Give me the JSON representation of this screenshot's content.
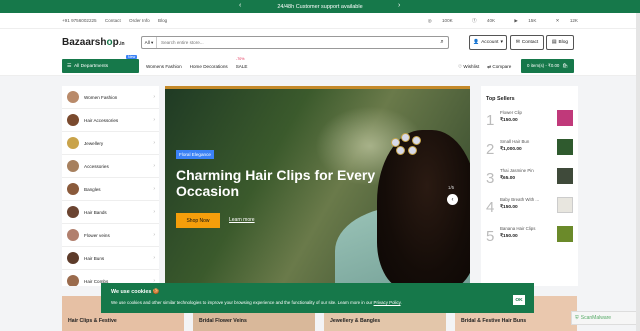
{
  "announcement": {
    "text": "24/48h Customer support available",
    "prev": "‹",
    "next": "›"
  },
  "topbar": {
    "phone": "+91 9756002225",
    "links": [
      "Contact",
      "Order Info",
      "Blog"
    ],
    "social": [
      {
        "icon": "instagram-icon",
        "glyph": "◎",
        "count": "100K"
      },
      {
        "icon": "facebook-icon",
        "glyph": "ⓕ",
        "count": "40K"
      },
      {
        "icon": "youtube-icon",
        "glyph": "▶",
        "count": "15K"
      },
      {
        "icon": "twitter-icon",
        "glyph": "✕",
        "count": "12K"
      }
    ]
  },
  "header": {
    "logo_main": "Bazaarsh",
    "logo_o": "o",
    "logo_end": "p",
    "logo_tld": ".in",
    "search_category": "All",
    "search_placeholder": "Search entire store...",
    "account_label": "Account",
    "contact_label": "Contact",
    "blog_label": "Blog"
  },
  "nav": {
    "all_departments": "All Departments",
    "new_badge": "New",
    "links": [
      "Womens Fashion",
      "Home Decorations",
      "SALE"
    ],
    "sale_badge": "-70%",
    "wishlist": "Wishlist",
    "compare": "Compare",
    "cart": "0 item(s) - ₹0.00"
  },
  "sidebar": {
    "items": [
      {
        "label": "Women Fashion",
        "color": "#b98a6a"
      },
      {
        "label": "Hair Accessories",
        "color": "#7a4a2e"
      },
      {
        "label": "Jewellery",
        "color": "#c9a34a"
      },
      {
        "label": "Accessories",
        "color": "#a7805e"
      },
      {
        "label": "Bangles",
        "color": "#8a5a3b"
      },
      {
        "label": "Hair Bands",
        "color": "#6b4431"
      },
      {
        "label": "Flower veins",
        "color": "#b17f6d"
      },
      {
        "label": "Hair Buns",
        "color": "#5d3b2a"
      },
      {
        "label": "Hair Combs",
        "color": "#9a6b4d"
      }
    ]
  },
  "hero": {
    "tag": "Floral Elegance",
    "title": "Charming Hair Clips for Every Occasion",
    "shop_now": "Shop Now",
    "learn_more": "Learn more",
    "counter": "1/5"
  },
  "top_sellers": {
    "title": "Top Sellers",
    "items": [
      {
        "rank": "1",
        "name": "Flower Clip",
        "price": "₹150.00",
        "color": "#c0397a"
      },
      {
        "rank": "2",
        "name": "Small Hair Bun",
        "price": "₹1,000.00",
        "color": "#2f5a2e"
      },
      {
        "rank": "3",
        "name": "Thai Jasmine Pin",
        "price": "₹65.00",
        "color": "#3f4a3a"
      },
      {
        "rank": "4",
        "name": "Baby Breath With ...",
        "price": "₹150.00",
        "color": "#e8e6df"
      },
      {
        "rank": "5",
        "name": "Banana Hair Clips",
        "price": "₹150.00",
        "color": "#6b8a2a"
      }
    ]
  },
  "bottom_categories": [
    {
      "label": "Hair Clips & Festive"
    },
    {
      "label": "Bridal Flower Veins"
    },
    {
      "label": "Jewellery & Bangles"
    },
    {
      "label": "Bridal & Festive Hair Buns"
    }
  ],
  "cookie": {
    "title": "We use cookies 🍪",
    "text": "We use cookies and other similar technologies to improve your browsing experience and the functionality of our site. Learn more in our",
    "policy_link": "Privacy Policy",
    "ok": "OK"
  },
  "badge": {
    "text": "ScanMalware"
  }
}
